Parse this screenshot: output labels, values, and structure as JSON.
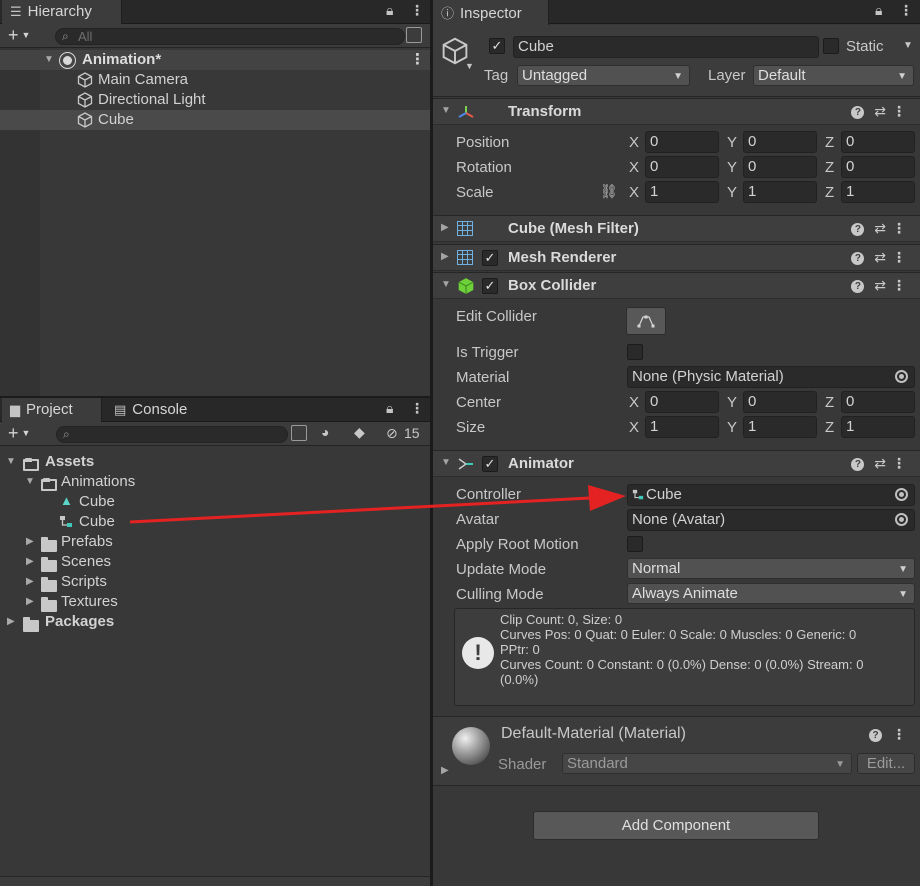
{
  "hierarchy": {
    "tab_label": "Hierarchy",
    "search_placeholder": "All",
    "scene_name": "Animation*",
    "items": [
      "Main Camera",
      "Directional Light",
      "Cube"
    ]
  },
  "project": {
    "tab_label": "Project",
    "console_tab_label": "Console",
    "hidden_count": "15",
    "tree": {
      "assets": "Assets",
      "animations": "Animations",
      "anim_clip": "Cube",
      "anim_controller": "Cube",
      "prefabs": "Prefabs",
      "scenes": "Scenes",
      "scripts": "Scripts",
      "textures": "Textures",
      "packages": "Packages"
    }
  },
  "inspector": {
    "tab_label": "Inspector",
    "object_name": "Cube",
    "static_label": "Static",
    "tag_label": "Tag",
    "tag_value": "Untagged",
    "layer_label": "Layer",
    "layer_value": "Default",
    "transform": {
      "title": "Transform",
      "position_label": "Position",
      "rotation_label": "Rotation",
      "scale_label": "Scale",
      "position": [
        "0",
        "0",
        "0"
      ],
      "rotation": [
        "0",
        "0",
        "0"
      ],
      "scale": [
        "1",
        "1",
        "1"
      ]
    },
    "axes": [
      "X",
      "Y",
      "Z"
    ],
    "mesh_filter_title": "Cube (Mesh Filter)",
    "mesh_renderer_title": "Mesh Renderer",
    "box_collider": {
      "title": "Box Collider",
      "edit_collider_label": "Edit Collider",
      "is_trigger_label": "Is Trigger",
      "material_label": "Material",
      "material_value": "None (Physic Material)",
      "center_label": "Center",
      "size_label": "Size",
      "center": [
        "0",
        "0",
        "0"
      ],
      "size": [
        "1",
        "1",
        "1"
      ]
    },
    "animator": {
      "title": "Animator",
      "controller_label": "Controller",
      "controller_value": "Cube",
      "avatar_label": "Avatar",
      "avatar_value": "None (Avatar)",
      "apply_root_motion_label": "Apply Root Motion",
      "update_mode_label": "Update Mode",
      "update_mode_value": "Normal",
      "culling_mode_label": "Culling Mode",
      "culling_mode_value": "Always Animate",
      "info_line1": "Clip Count: 0, Size: 0",
      "info_line2": "Curves Pos: 0 Quat: 0 Euler: 0 Scale: 0 Muscles: 0 Generic: 0",
      "info_line3": "PPtr: 0",
      "info_line4": "Curves Count: 0 Constant: 0 (0.0%) Dense: 0 (0.0%) Stream: 0",
      "info_line5": "(0.0%)"
    },
    "material": {
      "title": "Default-Material (Material)",
      "shader_label": "Shader",
      "shader_value": "Standard",
      "edit_label": "Edit..."
    },
    "add_component_label": "Add Component"
  },
  "colors": {
    "annotation_arrow": "#e52222",
    "panel_bg": "#383838"
  }
}
